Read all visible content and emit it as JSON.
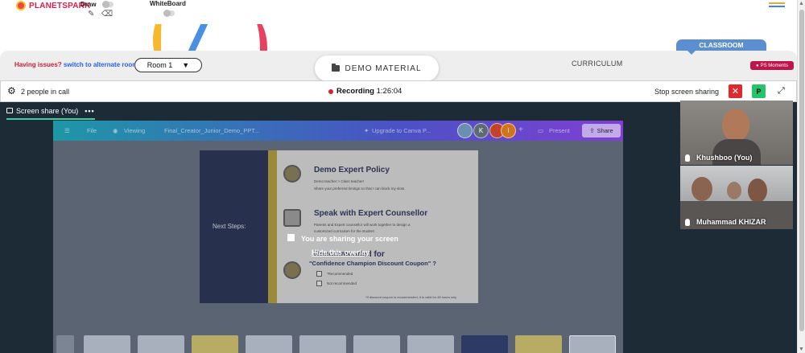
{
  "header": {
    "logo_text": "PLANETSPARK",
    "draw_label": "Draw",
    "whiteboard_label": "WhiteBoard",
    "menu_colors": [
      "#f5a623",
      "#3b82f6",
      "#22c55e"
    ]
  },
  "controls": {
    "issue_text": "Having issues?",
    "issue_link": "switch to alternate room",
    "room_value": "Room 1",
    "room_caret": "▼",
    "demo_material_label": "DEMO MATERIAL",
    "curriculum_label": "CURRICULUM",
    "classroom_label": "CLASSROOM",
    "ps_moments_label": "PS Moments"
  },
  "callbar": {
    "people_label": "2 people in call",
    "recording_label": "Recording",
    "recording_time": "1:26:04",
    "stop_share_label": "Stop screen sharing",
    "close_label": "✕",
    "p_label": "P"
  },
  "share": {
    "tab_label": "Screen share (You)",
    "tab_menu": "•••",
    "overlay_text": "You are sharing your screen",
    "hide_overlay_label": "Hide this overlay",
    "canva": {
      "file": "File",
      "viewing": "Viewing",
      "doc_title": "Final_Creator_Junior_Demo_PPT...",
      "upgrade": "Upgrade to Canva P...",
      "avatar_k": "K",
      "avatar_i": "I",
      "present": "Present",
      "share": "Share",
      "plus": "+"
    },
    "slide": {
      "next_steps": "Next Steps:",
      "policy_title": "Demo Expert Policy",
      "policy_line1": "Demo teacher > Class teacher!",
      "policy_line2": "Share your preferred timings so that I can block my slots.",
      "counsellor_title": "Speak with Expert Counsellor",
      "counsellor_line1": "Parents and Expert counsellor will work together to design a",
      "counsellor_line2": "customized curriculum for the student",
      "recommended_title": "Recommended for",
      "coupon_title": "\"Confidence Champion Discount Coupon\" ?",
      "opt1": "*Recommended",
      "opt2": "Not recommended",
      "footnote": "*If discount coupon is recommended, it is valid for 48 hours only"
    },
    "thumbnails": [
      "114",
      "111",
      "119",
      "118",
      "117",
      "111",
      "120"
    ]
  },
  "participants": [
    {
      "name": "Khushboo (You)"
    },
    {
      "name": "Muhammad KHIZAR"
    }
  ]
}
